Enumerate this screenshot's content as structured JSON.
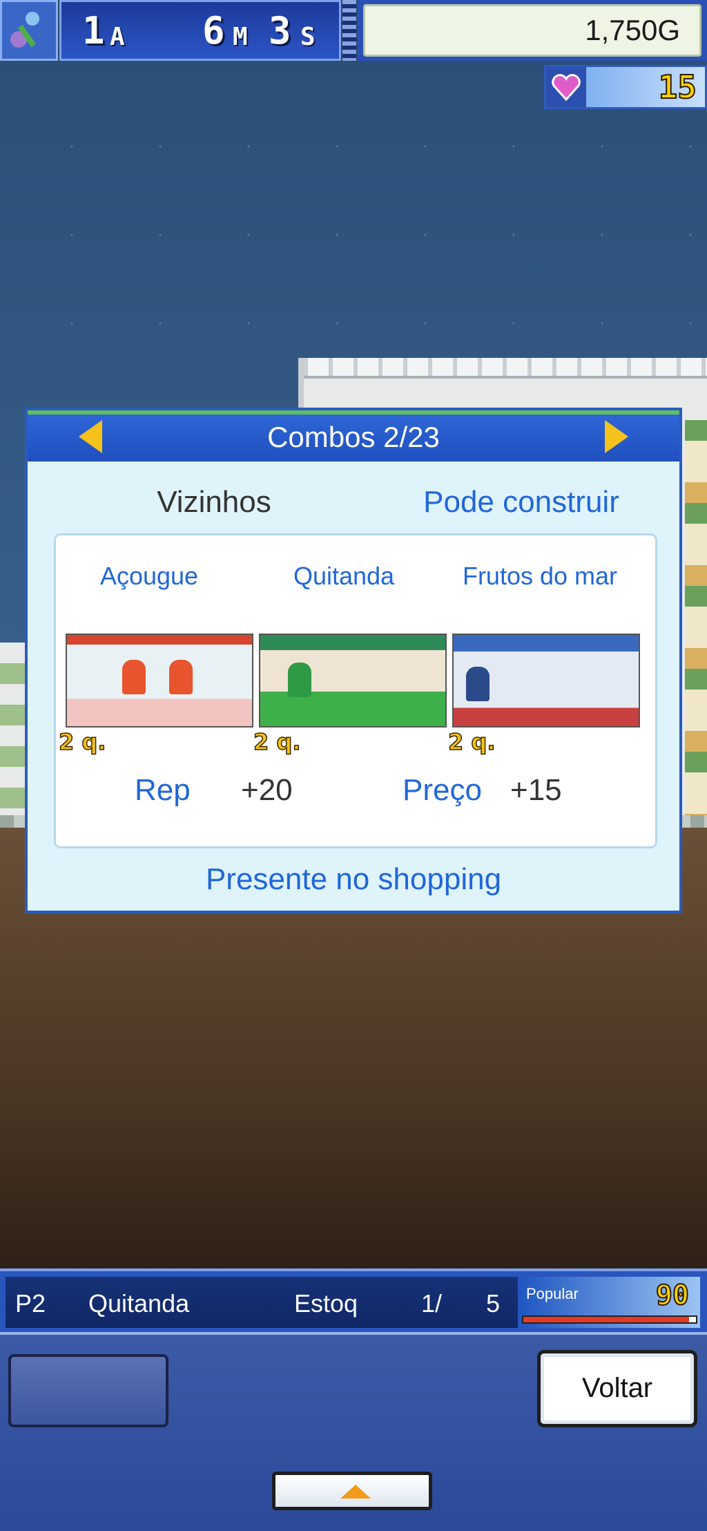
{
  "hud": {
    "year_value": "1",
    "year_unit": "A",
    "month_value": "6",
    "month_unit": "M",
    "week_value": "3",
    "week_unit": "S",
    "money": "1,750G",
    "hearts": "15"
  },
  "dialog": {
    "title": "Combos 2/23",
    "neighbors_label": "Vizinhos",
    "can_build_label": "Pode construir",
    "shops": [
      {
        "name": "Açougue",
        "qty": "2 q."
      },
      {
        "name": "Quitanda",
        "qty": "2 q."
      },
      {
        "name": "Frutos do mar",
        "qty": "2 q."
      }
    ],
    "bonuses": [
      {
        "label": "Rep",
        "value": "+20"
      },
      {
        "label": "Preço",
        "value": "+15"
      }
    ],
    "footer": "Presente no shopping"
  },
  "status_bar": {
    "floor": "P2",
    "shop": "Quitanda",
    "stock_label": "Estoq",
    "stock_current": "1/",
    "stock_max": "5",
    "popular_label": "Popular",
    "popular_value": "90",
    "popular_fraction": 0.96
  },
  "controls": {
    "back_label": "Voltar"
  },
  "colors": {
    "accent_blue": "#2067d8",
    "gold": "#f4c21a",
    "header_blue": "#1f4fbe"
  }
}
